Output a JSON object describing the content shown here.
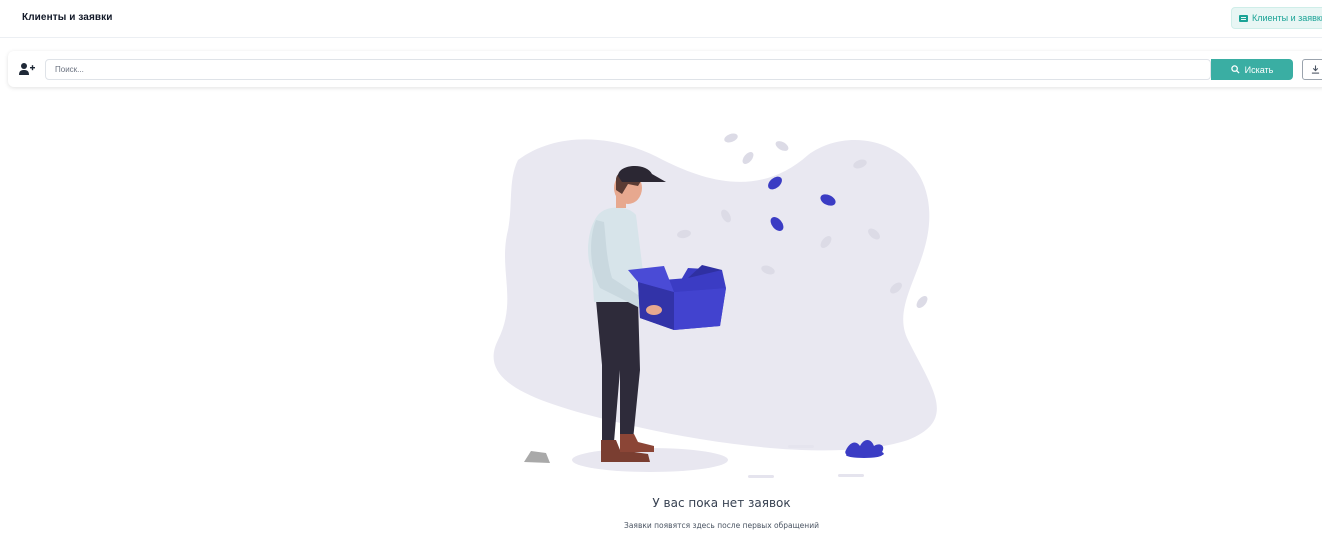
{
  "header": {
    "title": "Клиенты и заявки",
    "chip_label": "Клиенты и заявки",
    "chip_icon": "card-list-icon"
  },
  "search": {
    "placeholder": "Поиск...",
    "value": "",
    "button_label": "Искать",
    "button_icon": "search-icon",
    "add_icon": "add-user-icon",
    "export_icon": "download-icon"
  },
  "empty_state": {
    "title": "У вас пока нет заявок",
    "subtitle": "Заявки появятся здесь после первых обращений",
    "illustration": "person-holding-empty-box"
  },
  "colors": {
    "accent": "#3aaea3",
    "illustration_primary": "#3b3cc4",
    "blob": "#e9e8f1"
  }
}
